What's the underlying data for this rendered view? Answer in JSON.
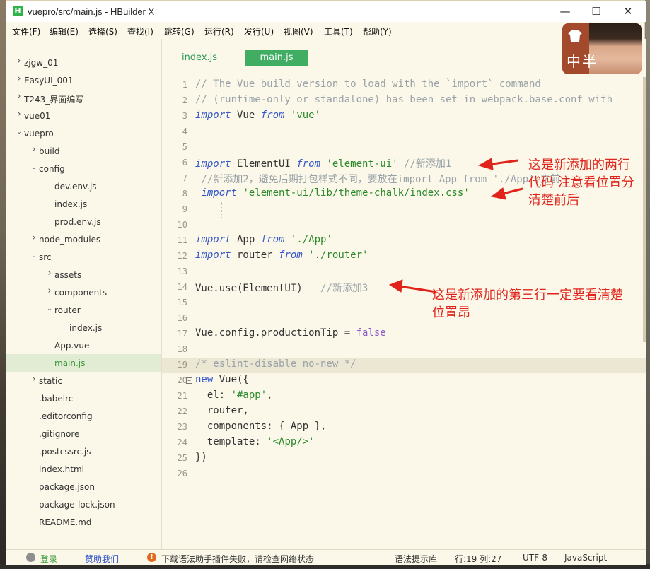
{
  "window": {
    "title": "vuepro/src/main.js - HBuilder X",
    "app_icon_letter": "H",
    "minimize": "—",
    "maximize": "☐",
    "close": "✕"
  },
  "menu": [
    "文件(F)",
    "编辑(E)",
    "选择(S)",
    "查找(I)",
    "跳转(G)",
    "运行(R)",
    "发行(U)",
    "视图(V)",
    "工具(T)",
    "帮助(Y)"
  ],
  "avatar": {
    "text": "中半"
  },
  "sidebar": {
    "items": [
      {
        "label": "zjgw_01",
        "depth": 0,
        "arrow": "right"
      },
      {
        "label": "EasyUI_001",
        "depth": 0,
        "arrow": "right"
      },
      {
        "label": "T243_界面编写",
        "depth": 0,
        "arrow": "right"
      },
      {
        "label": "vue01",
        "depth": 0,
        "arrow": "right"
      },
      {
        "label": "vuepro",
        "depth": 0,
        "arrow": "down"
      },
      {
        "label": "build",
        "depth": 1,
        "arrow": "right"
      },
      {
        "label": "config",
        "depth": 1,
        "arrow": "down"
      },
      {
        "label": "dev.env.js",
        "depth": 2,
        "arrow": ""
      },
      {
        "label": "index.js",
        "depth": 2,
        "arrow": ""
      },
      {
        "label": "prod.env.js",
        "depth": 2,
        "arrow": ""
      },
      {
        "label": "node_modules",
        "depth": 1,
        "arrow": "right"
      },
      {
        "label": "src",
        "depth": 1,
        "arrow": "down"
      },
      {
        "label": "assets",
        "depth": 2,
        "arrow": "right"
      },
      {
        "label": "components",
        "depth": 2,
        "arrow": "right"
      },
      {
        "label": "router",
        "depth": 2,
        "arrow": "down"
      },
      {
        "label": "index.js",
        "depth": 3,
        "arrow": ""
      },
      {
        "label": "App.vue",
        "depth": 2,
        "arrow": ""
      },
      {
        "label": "main.js",
        "depth": 2,
        "arrow": "",
        "selected": true
      },
      {
        "label": "static",
        "depth": 1,
        "arrow": "right"
      },
      {
        "label": ".babelrc",
        "depth": 1,
        "arrow": ""
      },
      {
        "label": ".editorconfig",
        "depth": 1,
        "arrow": ""
      },
      {
        "label": ".gitignore",
        "depth": 1,
        "arrow": ""
      },
      {
        "label": ".postcssrc.js",
        "depth": 1,
        "arrow": ""
      },
      {
        "label": "index.html",
        "depth": 1,
        "arrow": ""
      },
      {
        "label": "package.json",
        "depth": 1,
        "arrow": ""
      },
      {
        "label": "package-lock.json",
        "depth": 1,
        "arrow": ""
      },
      {
        "label": "README.md",
        "depth": 1,
        "arrow": ""
      }
    ]
  },
  "tabs": [
    {
      "label": "index.js",
      "active": false
    },
    {
      "label": "main.js",
      "active": true
    }
  ],
  "code": [
    {
      "n": "1",
      "tokens": [
        [
          "c-comment",
          "// The Vue build version to load with the `import` command"
        ]
      ]
    },
    {
      "n": "2",
      "tokens": [
        [
          "c-comment",
          "// (runtime-only or standalone) has been set in webpack.base.conf with"
        ]
      ]
    },
    {
      "n": "3",
      "tokens": [
        [
          "c-kw",
          "import"
        ],
        [
          "c-id",
          " Vue "
        ],
        [
          "c-kw",
          "from"
        ],
        [
          "c-id",
          " "
        ],
        [
          "c-str",
          "'vue'"
        ]
      ]
    },
    {
      "n": "4",
      "tokens": []
    },
    {
      "n": "5",
      "tokens": []
    },
    {
      "n": "6",
      "tokens": [
        [
          "c-kw",
          "import"
        ],
        [
          "c-id",
          " ElementUI "
        ],
        [
          "c-kw",
          "from"
        ],
        [
          "c-id",
          " "
        ],
        [
          "c-str",
          "'element-ui'"
        ],
        [
          "c-id",
          " "
        ],
        [
          "c-zh",
          "//新添加1"
        ]
      ]
    },
    {
      "n": "7",
      "tokens": [
        [
          "c-zh",
          " //新添加2，避免后期打包样式不同，要放在import App from './App';之前"
        ]
      ]
    },
    {
      "n": "8",
      "tokens": [
        [
          "c-id",
          " "
        ],
        [
          "c-kw",
          "import"
        ],
        [
          "c-id",
          " "
        ],
        [
          "c-str",
          "'element-ui/lib/theme-chalk/index.css'"
        ]
      ]
    },
    {
      "n": "9",
      "tokens": [],
      "guides": true
    },
    {
      "n": "10",
      "tokens": []
    },
    {
      "n": "11",
      "tokens": [
        [
          "c-kw",
          "import"
        ],
        [
          "c-id",
          " App "
        ],
        [
          "c-kw",
          "from"
        ],
        [
          "c-id",
          " "
        ],
        [
          "c-str",
          "'./App'"
        ]
      ]
    },
    {
      "n": "12",
      "tokens": [
        [
          "c-kw",
          "import"
        ],
        [
          "c-id",
          " router "
        ],
        [
          "c-kw",
          "from"
        ],
        [
          "c-id",
          " "
        ],
        [
          "c-str",
          "'./router'"
        ]
      ]
    },
    {
      "n": "13",
      "tokens": []
    },
    {
      "n": "14",
      "tokens": [
        [
          "c-id",
          "Vue.use(ElementUI)   "
        ],
        [
          "c-zh",
          "//新添加3"
        ]
      ]
    },
    {
      "n": "15",
      "tokens": []
    },
    {
      "n": "16",
      "tokens": []
    },
    {
      "n": "17",
      "tokens": [
        [
          "c-id",
          "Vue.config.productionTip = "
        ],
        [
          "c-val",
          "false"
        ]
      ]
    },
    {
      "n": "18",
      "tokens": []
    },
    {
      "n": "19",
      "tokens": [
        [
          "c-comment",
          "/* eslint-disable no-new */"
        ]
      ],
      "highlight": true
    },
    {
      "n": "20",
      "tokens": [
        [
          "c-kw2",
          "new"
        ],
        [
          "c-id",
          " Vue({"
        ]
      ],
      "fold": "−"
    },
    {
      "n": "21",
      "tokens": [
        [
          "c-id",
          "  el: "
        ],
        [
          "c-str",
          "'#app'"
        ],
        [
          "c-id",
          ","
        ]
      ]
    },
    {
      "n": "22",
      "tokens": [
        [
          "c-id",
          "  router,"
        ]
      ]
    },
    {
      "n": "23",
      "tokens": [
        [
          "c-id",
          "  components: { App },"
        ]
      ]
    },
    {
      "n": "24",
      "tokens": [
        [
          "c-id",
          "  template: "
        ],
        [
          "c-str",
          "'<App/>'"
        ]
      ]
    },
    {
      "n": "25",
      "tokens": [
        [
          "c-id",
          "})"
        ]
      ]
    },
    {
      "n": "26",
      "tokens": []
    }
  ],
  "annotations": {
    "first": [
      "这是新添加的两行",
      "代码 注意看位置分",
      "清楚前后"
    ],
    "second": [
      "这是新添加的第三行一定要看清楚",
      "位置昂"
    ],
    "color": "#e0241b"
  },
  "statusbar": {
    "login": "登录",
    "sponsor": "赞助我们",
    "warning": "下载语法助手插件失败，请检查网络状态",
    "syntax": "语法提示库",
    "position": "行:19  列:27",
    "encoding": "UTF-8",
    "language": "JavaScript"
  }
}
